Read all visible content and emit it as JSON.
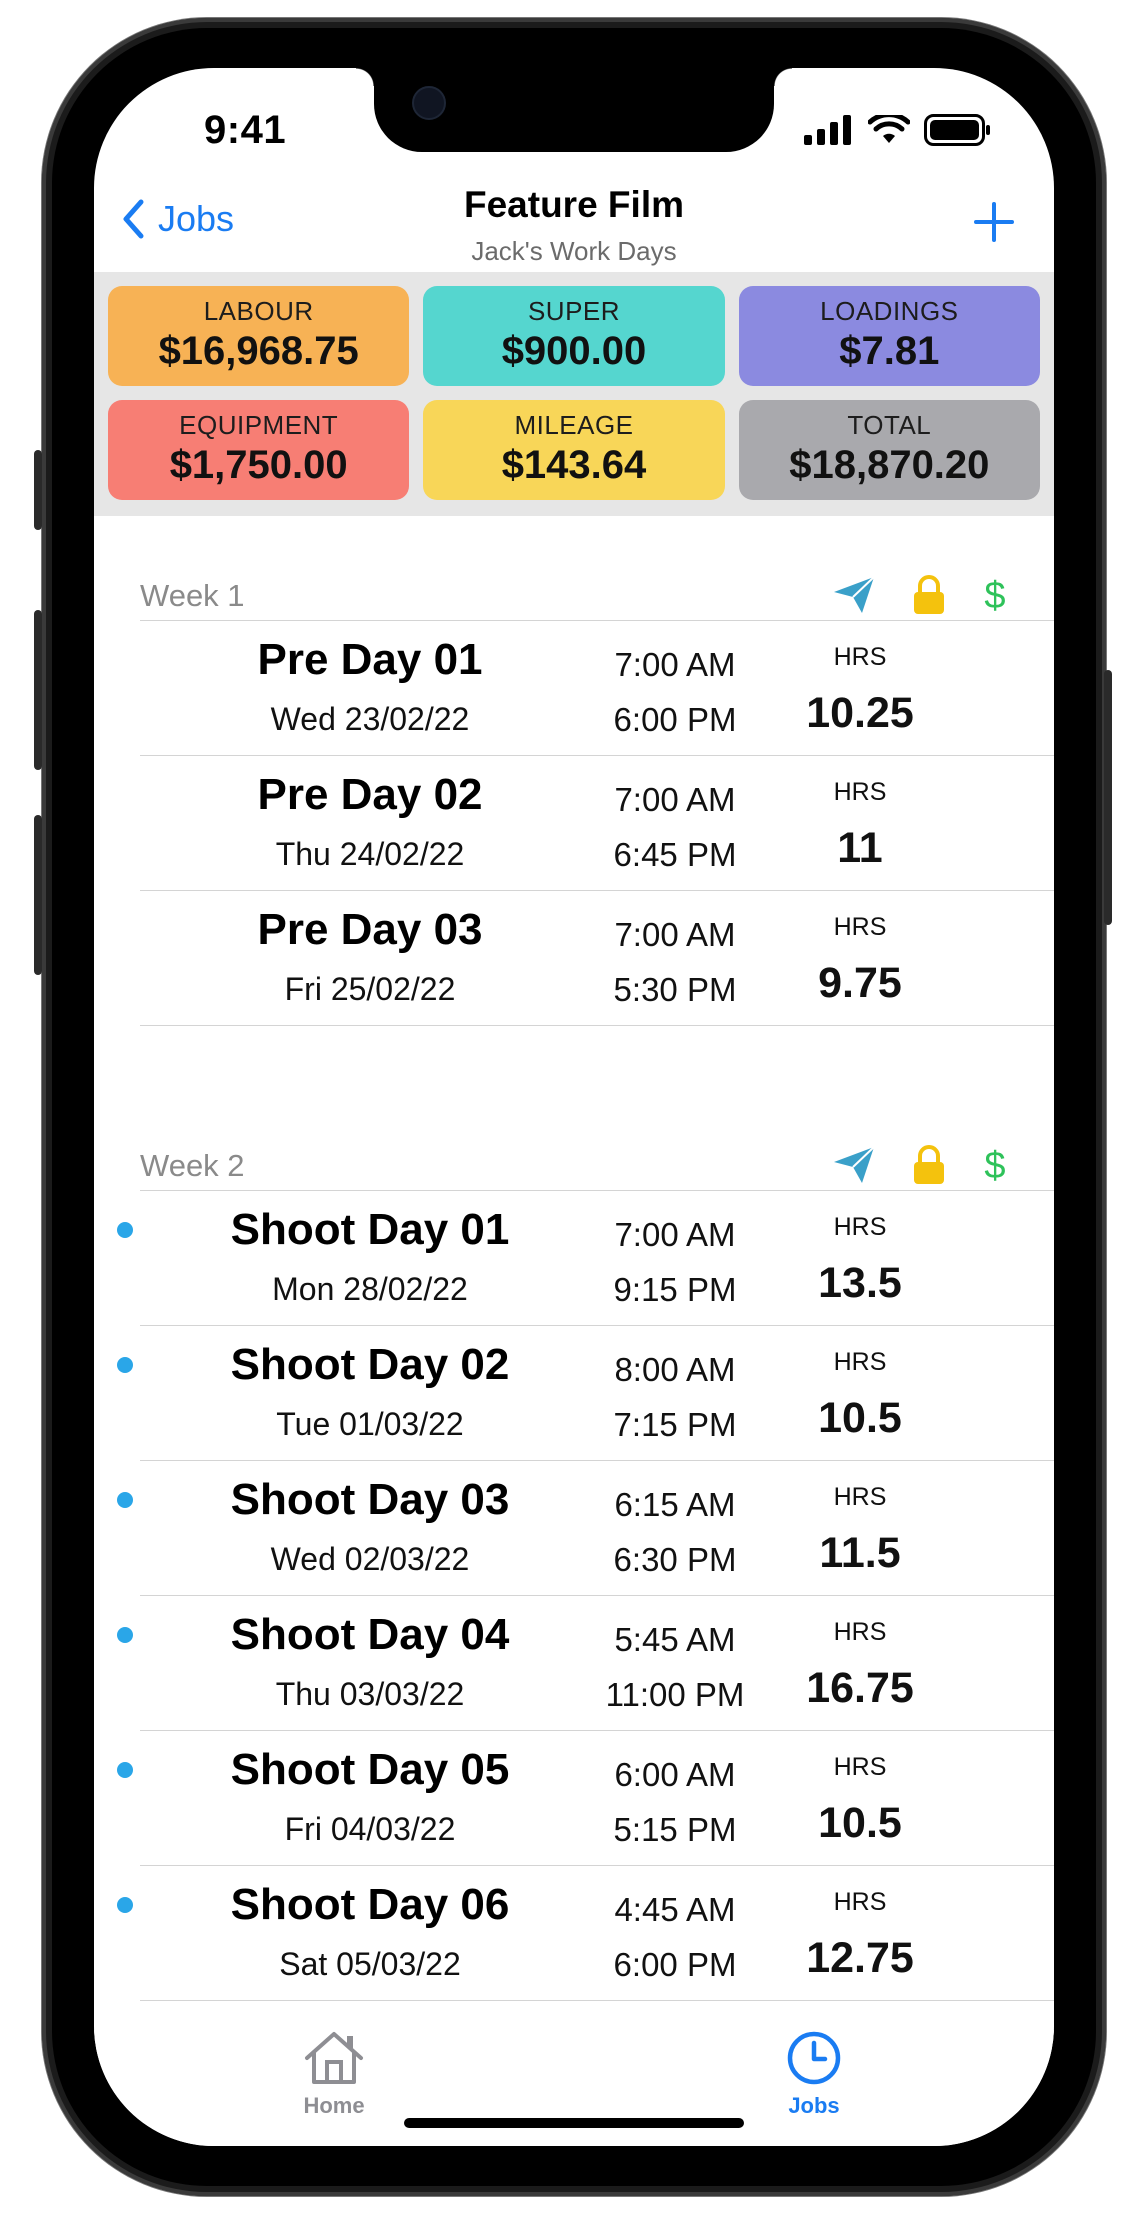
{
  "status": {
    "time": "9:41"
  },
  "nav": {
    "back_label": "Jobs",
    "title": "Feature Film",
    "subtitle": "Jack's Work Days",
    "add_icon": "plus-icon"
  },
  "summary": {
    "labour": {
      "label": "LABOUR",
      "value": "$16,968.75",
      "color": "#f7b255"
    },
    "super": {
      "label": "SUPER",
      "value": "$900.00",
      "color": "#55d6cf"
    },
    "loadings": {
      "label": "LOADINGS",
      "value": "$7.81",
      "color": "#8b8ae0"
    },
    "equipment": {
      "label": "EQUIPMENT",
      "value": "$1,750.00",
      "color": "#f77e74"
    },
    "mileage": {
      "label": "MILEAGE",
      "value": "$143.64",
      "color": "#f8d658"
    },
    "total": {
      "label": "TOTAL",
      "value": "$18,870.20",
      "color": "#a9a9ad"
    }
  },
  "weeks": [
    {
      "label": "Week 1",
      "days": [
        {
          "name": "Pre Day 01",
          "date": "Wed 23/02/22",
          "start": "7:00 AM",
          "end": "6:00 PM",
          "hrs_label": "HRS",
          "hrs": "10.25"
        },
        {
          "name": "Pre Day 02",
          "date": "Thu 24/02/22",
          "start": "7:00 AM",
          "end": "6:45 PM",
          "hrs_label": "HRS",
          "hrs": "11"
        },
        {
          "name": "Pre Day 03",
          "date": "Fri 25/02/22",
          "start": "7:00 AM",
          "end": "5:30 PM",
          "hrs_label": "HRS",
          "hrs": "9.75"
        }
      ]
    },
    {
      "label": "Week 2",
      "days": [
        {
          "name": "Shoot Day 01",
          "date": "Mon 28/02/22",
          "start": "7:00 AM",
          "end": "9:15 PM",
          "hrs_label": "HRS",
          "hrs": "13.5"
        },
        {
          "name": "Shoot Day 02",
          "date": "Tue 01/03/22",
          "start": "8:00 AM",
          "end": "7:15 PM",
          "hrs_label": "HRS",
          "hrs": "10.5"
        },
        {
          "name": "Shoot Day 03",
          "date": "Wed 02/03/22",
          "start": "6:15 AM",
          "end": "6:30 PM",
          "hrs_label": "HRS",
          "hrs": "11.5"
        },
        {
          "name": "Shoot Day 04",
          "date": "Thu 03/03/22",
          "start": "5:45 AM",
          "end": "11:00 PM",
          "hrs_label": "HRS",
          "hrs": "16.75"
        },
        {
          "name": "Shoot Day 05",
          "date": "Fri 04/03/22",
          "start": "6:00 AM",
          "end": "5:15 PM",
          "hrs_label": "HRS",
          "hrs": "10.5"
        },
        {
          "name": "Shoot Day 06",
          "date": "Sat 05/03/22",
          "start": "4:45 AM",
          "end": "6:00 PM",
          "hrs_label": "HRS",
          "hrs": "12.75"
        }
      ]
    }
  ],
  "week_icons": [
    "send-icon",
    "lock-icon",
    "dollar-icon"
  ],
  "tabs": [
    {
      "label": "Home",
      "icon": "house-icon",
      "active": false
    },
    {
      "label": "Jobs",
      "icon": "clock-icon",
      "active": true
    }
  ],
  "colors": {
    "accent": "#1a7cf2",
    "send": "#3aa0c9",
    "lock": "#f4c20d",
    "dollar": "#2ec25a",
    "dot": "#2aa6e8",
    "tab_inactive": "#8e8e93"
  }
}
